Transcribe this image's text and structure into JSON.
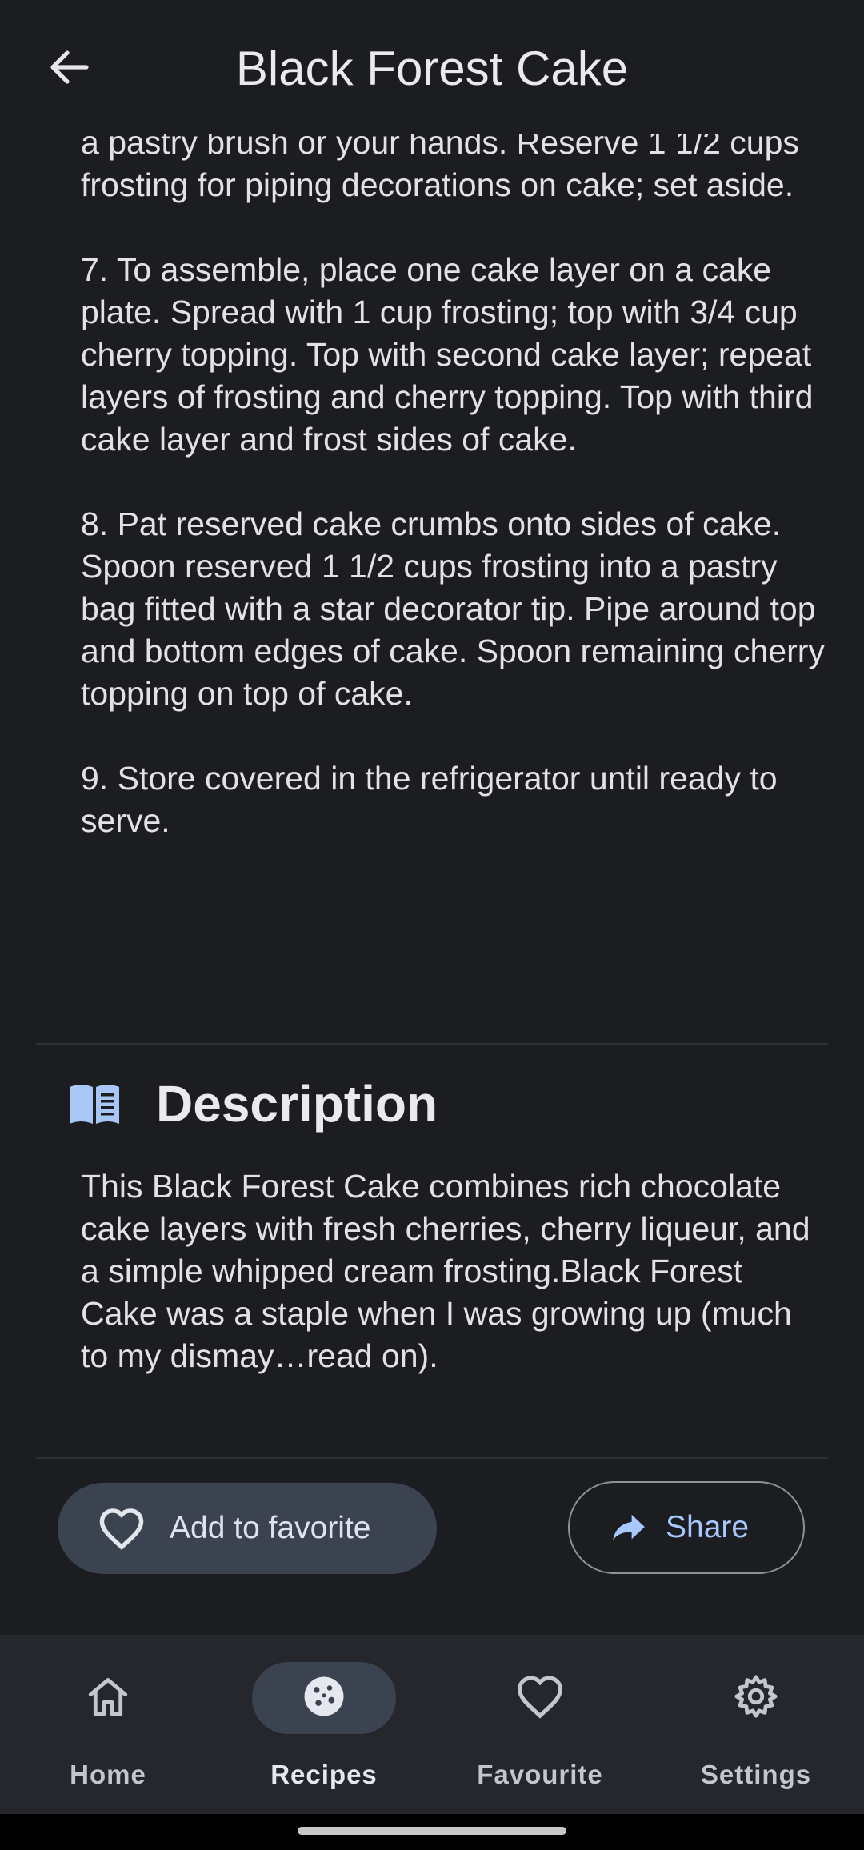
{
  "header": {
    "title": "Black Forest Cake",
    "back_icon": "arrow-back-icon"
  },
  "steps": [
    "a pastry brush or your hands. Reserve 1 1/2 cups frosting for piping decorations on cake; set aside.",
    "7.  To assemble, place one cake layer on a cake plate. Spread with 1 cup frosting; top with 3/4 cup cherry topping. Top with second cake layer; repeat layers of frosting and cherry topping. Top with third cake layer and frost sides of cake.",
    "8.  Pat reserved cake crumbs onto sides of cake. Spoon reserved 1 1/2 cups frosting into a pastry bag fitted with a star decorator tip. Pipe around top and bottom edges of cake. Spoon remaining cherry topping on top of cake.",
    "9.  Store covered in the refrigerator until ready to serve."
  ],
  "description": {
    "icon": "menu-book-icon",
    "title": "Description",
    "text": "This Black Forest Cake combines rich chocolate cake layers with fresh cherries, cherry liqueur, and a simple whipped cream frosting.Black Forest Cake was a staple when I was growing up (much to my dismay…read on)."
  },
  "actions": {
    "favorite_label": "Add to favorite",
    "favorite_icon": "heart-outline-icon",
    "share_label": "Share",
    "share_icon": "share-arrow-icon"
  },
  "bottom_nav": {
    "items": [
      {
        "label": "Home",
        "icon": "home-icon",
        "active": false
      },
      {
        "label": "Recipes",
        "icon": "cookie-icon",
        "active": true
      },
      {
        "label": "Favourite",
        "icon": "heart-outline-icon",
        "active": false
      },
      {
        "label": "Settings",
        "icon": "gear-icon",
        "active": false
      }
    ]
  },
  "colors": {
    "background": "#1c1d21",
    "nav_background": "#25272d",
    "active_pill": "#3c4350",
    "accent_blue": "#a7c8ff",
    "text": "#e4e1e6"
  }
}
